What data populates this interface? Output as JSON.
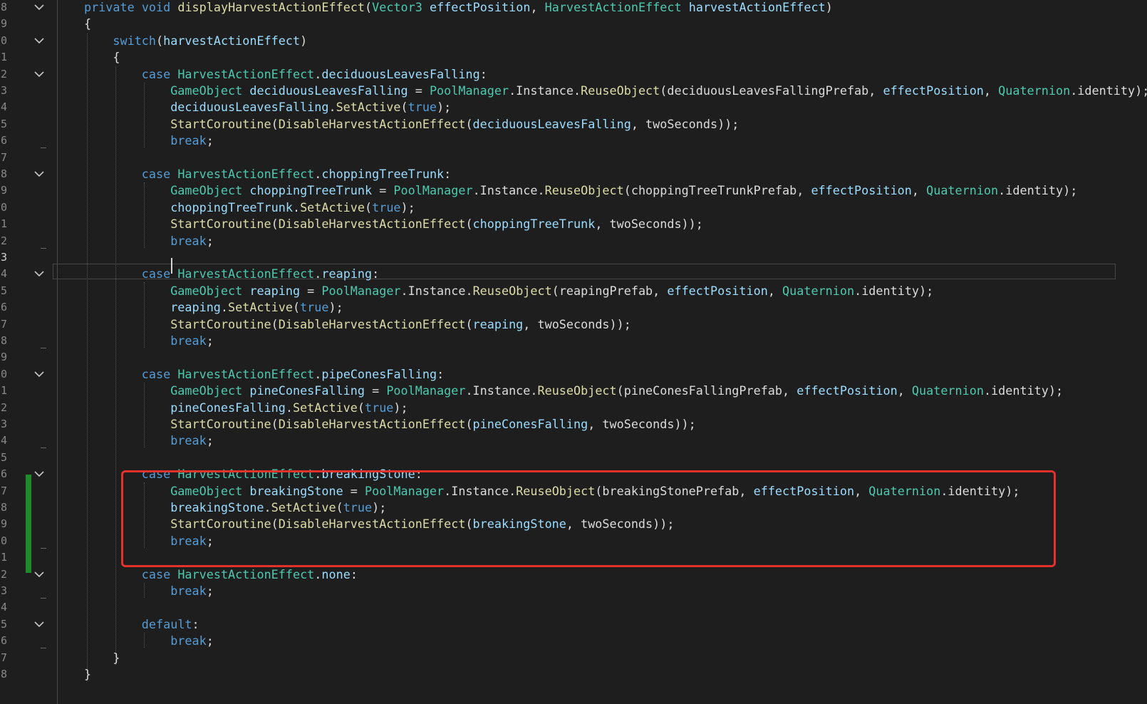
{
  "editor": {
    "current_line_number": "3",
    "highlight_color": "#e3312b",
    "change_marker_color": "#1f8a2a",
    "theme_colors": {
      "keyword": "#569cd6",
      "type": "#4ec9b0",
      "method": "#dcdcaa",
      "variable": "#9cdcfe",
      "plain": "#dcdcdc"
    },
    "lines": [
      {
        "ln": "8",
        "fold": true,
        "indent": 0,
        "tokens": [
          [
            "kw",
            "private void "
          ],
          [
            "mt",
            "displayHarvestActionEffect"
          ],
          [
            "pl",
            "("
          ],
          [
            "ty",
            "Vector3"
          ],
          [
            "pl",
            " "
          ],
          [
            "va",
            "effectPosition"
          ],
          [
            "pl",
            ", "
          ],
          [
            "ty",
            "HarvestActionEffect"
          ],
          [
            "pl",
            " "
          ],
          [
            "va",
            "harvestActionEffect"
          ],
          [
            "pl",
            ")"
          ]
        ]
      },
      {
        "ln": "9",
        "fold": false,
        "indent": 0,
        "tokens": [
          [
            "pl",
            "{"
          ]
        ]
      },
      {
        "ln": "0",
        "fold": true,
        "indent": 1,
        "tokens": [
          [
            "kw",
            "switch"
          ],
          [
            "pl",
            "("
          ],
          [
            "va",
            "harvestActionEffect"
          ],
          [
            "pl",
            ")"
          ]
        ]
      },
      {
        "ln": "1",
        "fold": false,
        "indent": 1,
        "tokens": [
          [
            "pl",
            "{"
          ]
        ]
      },
      {
        "ln": "2",
        "fold": true,
        "indent": 2,
        "tokens": [
          [
            "kw",
            "case "
          ],
          [
            "ty",
            "HarvestActionEffect"
          ],
          [
            "pl",
            "."
          ],
          [
            "va",
            "deciduousLeavesFalling"
          ],
          [
            "pl",
            ":"
          ]
        ]
      },
      {
        "ln": "3",
        "fold": false,
        "indent": 3,
        "tokens": [
          [
            "ty",
            "GameObject"
          ],
          [
            "pl",
            " "
          ],
          [
            "va",
            "deciduousLeavesFalling"
          ],
          [
            "pl",
            " = "
          ],
          [
            "ty",
            "PoolManager"
          ],
          [
            "pl",
            ".Instance."
          ],
          [
            "mt",
            "ReuseObject"
          ],
          [
            "pl",
            "(deciduousLeavesFallingPrefab, "
          ],
          [
            "va",
            "effectPosition"
          ],
          [
            "pl",
            ", "
          ],
          [
            "ty",
            "Quaternion"
          ],
          [
            "pl",
            ".identity);"
          ]
        ]
      },
      {
        "ln": "4",
        "fold": false,
        "indent": 3,
        "tokens": [
          [
            "va",
            "deciduousLeavesFalling"
          ],
          [
            "pl",
            "."
          ],
          [
            "mt",
            "SetActive"
          ],
          [
            "pl",
            "("
          ],
          [
            "kw",
            "true"
          ],
          [
            "pl",
            ");"
          ]
        ]
      },
      {
        "ln": "5",
        "fold": false,
        "indent": 3,
        "tokens": [
          [
            "mt",
            "StartCoroutine"
          ],
          [
            "pl",
            "("
          ],
          [
            "mt",
            "DisableHarvestActionEffect"
          ],
          [
            "pl",
            "("
          ],
          [
            "va",
            "deciduousLeavesFalling"
          ],
          [
            "pl",
            ", twoSeconds));"
          ]
        ]
      },
      {
        "ln": "6",
        "fold": false,
        "indent": 3,
        "tokens": [
          [
            "kw",
            "break"
          ],
          [
            "pl",
            ";"
          ]
        ]
      },
      {
        "ln": "7",
        "fold": false,
        "indent": 0,
        "tokens": []
      },
      {
        "ln": "8",
        "fold": true,
        "indent": 2,
        "tokens": [
          [
            "kw",
            "case "
          ],
          [
            "ty",
            "HarvestActionEffect"
          ],
          [
            "pl",
            "."
          ],
          [
            "va",
            "choppingTreeTrunk"
          ],
          [
            "pl",
            ":"
          ]
        ]
      },
      {
        "ln": "9",
        "fold": false,
        "indent": 3,
        "tokens": [
          [
            "ty",
            "GameObject"
          ],
          [
            "pl",
            " "
          ],
          [
            "va",
            "choppingTreeTrunk"
          ],
          [
            "pl",
            " = "
          ],
          [
            "ty",
            "PoolManager"
          ],
          [
            "pl",
            ".Instance."
          ],
          [
            "mt",
            "ReuseObject"
          ],
          [
            "pl",
            "(choppingTreeTrunkPrefab, "
          ],
          [
            "va",
            "effectPosition"
          ],
          [
            "pl",
            ", "
          ],
          [
            "ty",
            "Quaternion"
          ],
          [
            "pl",
            ".identity);"
          ]
        ]
      },
      {
        "ln": "0",
        "fold": false,
        "indent": 3,
        "tokens": [
          [
            "va",
            "choppingTreeTrunk"
          ],
          [
            "pl",
            "."
          ],
          [
            "mt",
            "SetActive"
          ],
          [
            "pl",
            "("
          ],
          [
            "kw",
            "true"
          ],
          [
            "pl",
            ");"
          ]
        ]
      },
      {
        "ln": "1",
        "fold": false,
        "indent": 3,
        "tokens": [
          [
            "mt",
            "StartCoroutine"
          ],
          [
            "pl",
            "("
          ],
          [
            "mt",
            "DisableHarvestActionEffect"
          ],
          [
            "pl",
            "("
          ],
          [
            "va",
            "choppingTreeTrunk"
          ],
          [
            "pl",
            ", twoSeconds));"
          ]
        ]
      },
      {
        "ln": "2",
        "fold": false,
        "indent": 3,
        "tokens": [
          [
            "kw",
            "break"
          ],
          [
            "pl",
            ";"
          ]
        ]
      },
      {
        "ln": "3",
        "fold": false,
        "indent": 0,
        "tokens": [],
        "current": true
      },
      {
        "ln": "4",
        "fold": true,
        "indent": 2,
        "tokens": [
          [
            "kw",
            "case "
          ],
          [
            "ty",
            "HarvestActionEffect"
          ],
          [
            "pl",
            "."
          ],
          [
            "va",
            "reaping"
          ],
          [
            "pl",
            ":"
          ]
        ]
      },
      {
        "ln": "5",
        "fold": false,
        "indent": 3,
        "tokens": [
          [
            "ty",
            "GameObject"
          ],
          [
            "pl",
            " "
          ],
          [
            "va",
            "reaping"
          ],
          [
            "pl",
            " = "
          ],
          [
            "ty",
            "PoolManager"
          ],
          [
            "pl",
            ".Instance."
          ],
          [
            "mt",
            "ReuseObject"
          ],
          [
            "pl",
            "(reapingPrefab, "
          ],
          [
            "va",
            "effectPosition"
          ],
          [
            "pl",
            ", "
          ],
          [
            "ty",
            "Quaternion"
          ],
          [
            "pl",
            ".identity);"
          ]
        ]
      },
      {
        "ln": "6",
        "fold": false,
        "indent": 3,
        "tokens": [
          [
            "va",
            "reaping"
          ],
          [
            "pl",
            "."
          ],
          [
            "mt",
            "SetActive"
          ],
          [
            "pl",
            "("
          ],
          [
            "kw",
            "true"
          ],
          [
            "pl",
            ");"
          ]
        ]
      },
      {
        "ln": "7",
        "fold": false,
        "indent": 3,
        "tokens": [
          [
            "mt",
            "StartCoroutine"
          ],
          [
            "pl",
            "("
          ],
          [
            "mt",
            "DisableHarvestActionEffect"
          ],
          [
            "pl",
            "("
          ],
          [
            "va",
            "reaping"
          ],
          [
            "pl",
            ", twoSeconds));"
          ]
        ]
      },
      {
        "ln": "8",
        "fold": false,
        "indent": 3,
        "tokens": [
          [
            "kw",
            "break"
          ],
          [
            "pl",
            ";"
          ]
        ]
      },
      {
        "ln": "9",
        "fold": false,
        "indent": 0,
        "tokens": []
      },
      {
        "ln": "0",
        "fold": true,
        "indent": 2,
        "tokens": [
          [
            "kw",
            "case "
          ],
          [
            "ty",
            "HarvestActionEffect"
          ],
          [
            "pl",
            "."
          ],
          [
            "va",
            "pipeConesFalling"
          ],
          [
            "pl",
            ":"
          ]
        ]
      },
      {
        "ln": "1",
        "fold": false,
        "indent": 3,
        "tokens": [
          [
            "ty",
            "GameObject"
          ],
          [
            "pl",
            " "
          ],
          [
            "va",
            "pineConesFalling"
          ],
          [
            "pl",
            " = "
          ],
          [
            "ty",
            "PoolManager"
          ],
          [
            "pl",
            ".Instance."
          ],
          [
            "mt",
            "ReuseObject"
          ],
          [
            "pl",
            "(pineConesFallingPrefab, "
          ],
          [
            "va",
            "effectPosition"
          ],
          [
            "pl",
            ", "
          ],
          [
            "ty",
            "Quaternion"
          ],
          [
            "pl",
            ".identity);"
          ]
        ]
      },
      {
        "ln": "2",
        "fold": false,
        "indent": 3,
        "tokens": [
          [
            "va",
            "pineConesFalling"
          ],
          [
            "pl",
            "."
          ],
          [
            "mt",
            "SetActive"
          ],
          [
            "pl",
            "("
          ],
          [
            "kw",
            "true"
          ],
          [
            "pl",
            ");"
          ]
        ]
      },
      {
        "ln": "3",
        "fold": false,
        "indent": 3,
        "tokens": [
          [
            "mt",
            "StartCoroutine"
          ],
          [
            "pl",
            "("
          ],
          [
            "mt",
            "DisableHarvestActionEffect"
          ],
          [
            "pl",
            "("
          ],
          [
            "va",
            "pineConesFalling"
          ],
          [
            "pl",
            ", twoSeconds));"
          ]
        ]
      },
      {
        "ln": "4",
        "fold": false,
        "indent": 3,
        "tokens": [
          [
            "kw",
            "break"
          ],
          [
            "pl",
            ";"
          ]
        ]
      },
      {
        "ln": "5",
        "fold": false,
        "indent": 0,
        "tokens": []
      },
      {
        "ln": "6",
        "fold": true,
        "indent": 2,
        "tokens": [
          [
            "kw",
            "case "
          ],
          [
            "ty",
            "HarvestActionEffect"
          ],
          [
            "pl",
            "."
          ],
          [
            "va",
            "breakingStone"
          ],
          [
            "pl",
            ":"
          ]
        ]
      },
      {
        "ln": "7",
        "fold": false,
        "indent": 3,
        "tokens": [
          [
            "ty",
            "GameObject"
          ],
          [
            "pl",
            " "
          ],
          [
            "va",
            "breakingStone"
          ],
          [
            "pl",
            " = "
          ],
          [
            "ty",
            "PoolManager"
          ],
          [
            "pl",
            ".Instance."
          ],
          [
            "mt",
            "ReuseObject"
          ],
          [
            "pl",
            "(breakingStonePrefab, "
          ],
          [
            "va",
            "effectPosition"
          ],
          [
            "pl",
            ", "
          ],
          [
            "ty",
            "Quaternion"
          ],
          [
            "pl",
            ".identity);"
          ]
        ]
      },
      {
        "ln": "8",
        "fold": false,
        "indent": 3,
        "tokens": [
          [
            "va",
            "breakingStone"
          ],
          [
            "pl",
            "."
          ],
          [
            "mt",
            "SetActive"
          ],
          [
            "pl",
            "("
          ],
          [
            "kw",
            "true"
          ],
          [
            "pl",
            ");"
          ]
        ]
      },
      {
        "ln": "9",
        "fold": false,
        "indent": 3,
        "tokens": [
          [
            "mt",
            "StartCoroutine"
          ],
          [
            "pl",
            "("
          ],
          [
            "mt",
            "DisableHarvestActionEffect"
          ],
          [
            "pl",
            "("
          ],
          [
            "va",
            "breakingStone"
          ],
          [
            "pl",
            ", twoSeconds));"
          ]
        ]
      },
      {
        "ln": "0",
        "fold": false,
        "indent": 3,
        "tokens": [
          [
            "kw",
            "break"
          ],
          [
            "pl",
            ";"
          ]
        ]
      },
      {
        "ln": "1",
        "fold": false,
        "indent": 0,
        "tokens": []
      },
      {
        "ln": "2",
        "fold": true,
        "indent": 2,
        "tokens": [
          [
            "kw",
            "case "
          ],
          [
            "ty",
            "HarvestActionEffect"
          ],
          [
            "pl",
            "."
          ],
          [
            "va",
            "none"
          ],
          [
            "pl",
            ":"
          ]
        ]
      },
      {
        "ln": "3",
        "fold": false,
        "indent": 3,
        "tokens": [
          [
            "kw",
            "break"
          ],
          [
            "pl",
            ";"
          ]
        ]
      },
      {
        "ln": "4",
        "fold": false,
        "indent": 0,
        "tokens": []
      },
      {
        "ln": "5",
        "fold": true,
        "indent": 2,
        "tokens": [
          [
            "kw",
            "default"
          ],
          [
            "pl",
            ":"
          ]
        ]
      },
      {
        "ln": "6",
        "fold": false,
        "indent": 3,
        "tokens": [
          [
            "kw",
            "break"
          ],
          [
            "pl",
            ";"
          ]
        ]
      },
      {
        "ln": "7",
        "fold": false,
        "indent": 1,
        "tokens": [
          [
            "pl",
            "}"
          ]
        ]
      },
      {
        "ln": "8",
        "fold": false,
        "indent": 0,
        "tokens": [
          [
            "pl",
            "}"
          ]
        ]
      }
    ]
  }
}
